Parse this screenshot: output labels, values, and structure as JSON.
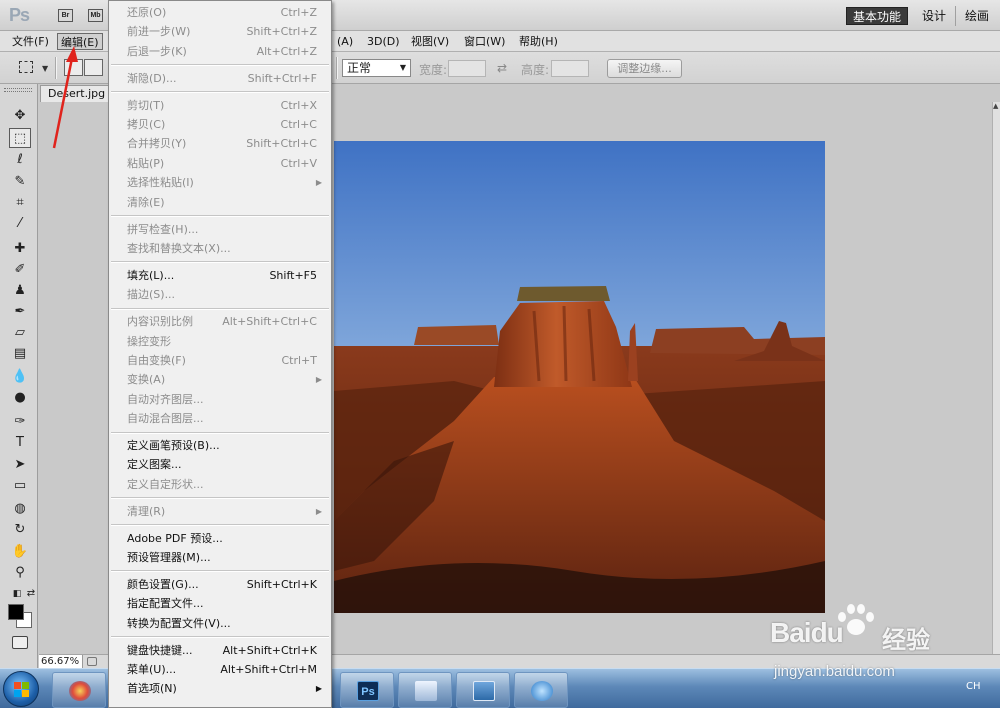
{
  "app": {
    "logo_text": "Ps",
    "bridge_icon": "Br",
    "minibridge_icon": "Mb",
    "workspaces": [
      "基本功能",
      "设计",
      "绘画"
    ]
  },
  "menubar": {
    "file": "文件(F)",
    "edit": "编辑(E)",
    "hidden_menu_end": "(A)",
    "threed": "3D(D)",
    "view": "视图(V)",
    "window": "窗口(W)",
    "help": "帮助(H)"
  },
  "options": {
    "style_value": "正常",
    "width_label": "宽度:",
    "height_label": "高度:",
    "swap_symbol": "⇄",
    "refine_edge_label": "调整边缘..."
  },
  "document": {
    "tab_title": "Desert.jpg @",
    "zoom": "66.67%"
  },
  "edit_menu": {
    "groups": [
      [
        {
          "label": "还原(O)",
          "shortcut": "Ctrl+Z",
          "enabled": false
        },
        {
          "label": "前进一步(W)",
          "shortcut": "Shift+Ctrl+Z",
          "enabled": false
        },
        {
          "label": "后退一步(K)",
          "shortcut": "Alt+Ctrl+Z",
          "enabled": false
        }
      ],
      [
        {
          "label": "渐隐(D)...",
          "shortcut": "Shift+Ctrl+F",
          "enabled": false
        }
      ],
      [
        {
          "label": "剪切(T)",
          "shortcut": "Ctrl+X",
          "enabled": false
        },
        {
          "label": "拷贝(C)",
          "shortcut": "Ctrl+C",
          "enabled": false
        },
        {
          "label": "合并拷贝(Y)",
          "shortcut": "Shift+Ctrl+C",
          "enabled": false
        },
        {
          "label": "粘贴(P)",
          "shortcut": "Ctrl+V",
          "enabled": false
        },
        {
          "label": "选择性粘贴(I)",
          "shortcut": "",
          "enabled": false,
          "submenu": true
        },
        {
          "label": "清除(E)",
          "shortcut": "",
          "enabled": false
        }
      ],
      [
        {
          "label": "拼写检查(H)...",
          "shortcut": "",
          "enabled": false
        },
        {
          "label": "查找和替换文本(X)...",
          "shortcut": "",
          "enabled": false
        }
      ],
      [
        {
          "label": "填充(L)...",
          "shortcut": "Shift+F5",
          "enabled": true
        },
        {
          "label": "描边(S)...",
          "shortcut": "",
          "enabled": false
        }
      ],
      [
        {
          "label": "内容识别比例",
          "shortcut": "Alt+Shift+Ctrl+C",
          "enabled": false
        },
        {
          "label": "操控变形",
          "shortcut": "",
          "enabled": false
        },
        {
          "label": "自由变换(F)",
          "shortcut": "Ctrl+T",
          "enabled": false
        },
        {
          "label": "变换(A)",
          "shortcut": "",
          "enabled": false,
          "submenu": true
        },
        {
          "label": "自动对齐图层...",
          "shortcut": "",
          "enabled": false
        },
        {
          "label": "自动混合图层...",
          "shortcut": "",
          "enabled": false
        }
      ],
      [
        {
          "label": "定义画笔预设(B)...",
          "shortcut": "",
          "enabled": true
        },
        {
          "label": "定义图案...",
          "shortcut": "",
          "enabled": true
        },
        {
          "label": "定义自定形状...",
          "shortcut": "",
          "enabled": false
        }
      ],
      [
        {
          "label": "清理(R)",
          "shortcut": "",
          "enabled": false,
          "submenu": true
        }
      ],
      [
        {
          "label": "Adobe PDF 预设...",
          "shortcut": "",
          "enabled": true
        },
        {
          "label": "预设管理器(M)...",
          "shortcut": "",
          "enabled": true
        }
      ],
      [
        {
          "label": "颜色设置(G)...",
          "shortcut": "Shift+Ctrl+K",
          "enabled": true
        },
        {
          "label": "指定配置文件...",
          "shortcut": "",
          "enabled": true
        },
        {
          "label": "转换为配置文件(V)...",
          "shortcut": "",
          "enabled": true
        }
      ],
      [
        {
          "label": "键盘快捷键...",
          "shortcut": "Alt+Shift+Ctrl+K",
          "enabled": true
        },
        {
          "label": "菜单(U)...",
          "shortcut": "Alt+Shift+Ctrl+M",
          "enabled": true
        },
        {
          "label": "首选项(N)",
          "shortcut": "",
          "enabled": true,
          "submenu": true
        }
      ]
    ]
  },
  "taskbar": {
    "photoshop_label": "Ps",
    "tray_text": "CH"
  },
  "watermark": {
    "brand": "Baidu",
    "brand_cn": "经验",
    "url": "jingyan.baidu.com"
  },
  "colors": {
    "annotation_arrow": "#e0231c",
    "menu_disabled_text": "#8c8c8c",
    "workspace_active_bg": "#3a3a3a"
  }
}
